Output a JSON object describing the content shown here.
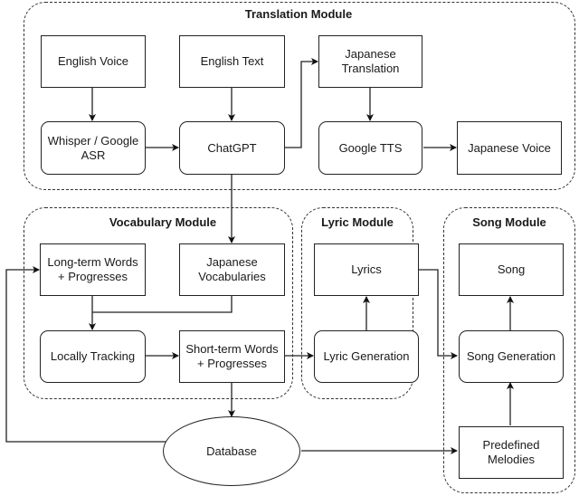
{
  "modules": {
    "translation": {
      "title": "Translation Module"
    },
    "vocabulary": {
      "title": "Vocabulary Module"
    },
    "lyric": {
      "title": "Lyric Module"
    },
    "song": {
      "title": "Song Module"
    }
  },
  "nodes": {
    "english_voice": "English Voice",
    "english_text": "English Text",
    "japanese_translation": "Japanese Translation",
    "whisper_asr": "Whisper / Google ASR",
    "chatgpt": "ChatGPT",
    "google_tts": "Google TTS",
    "japanese_voice": "Japanese Voice",
    "long_term_words": "Long-term Words + Progresses",
    "japanese_vocabularies": "Japanese Vocabularies",
    "locally_tracking": "Locally Tracking",
    "short_term_words": "Short-term Words + Progresses",
    "lyrics": "Lyrics",
    "lyric_generation": "Lyric Generation",
    "song": "Song",
    "song_generation": "Song Generation",
    "database": "Database",
    "predefined_melodies": "Predefined Melodies"
  },
  "edges": [
    {
      "from": "English Voice",
      "to": "Whisper / Google ASR"
    },
    {
      "from": "English Text",
      "to": "ChatGPT"
    },
    {
      "from": "Whisper / Google ASR",
      "to": "ChatGPT"
    },
    {
      "from": "ChatGPT",
      "to": "Japanese Translation"
    },
    {
      "from": "Japanese Translation",
      "to": "Google TTS"
    },
    {
      "from": "Google TTS",
      "to": "Japanese Voice"
    },
    {
      "from": "ChatGPT",
      "to": "Japanese Vocabularies"
    },
    {
      "from": "Long-term Words + Progresses",
      "to": "Locally Tracking"
    },
    {
      "from": "Japanese Vocabularies",
      "to": "Locally Tracking"
    },
    {
      "from": "Locally Tracking",
      "to": "Short-term Words + Progresses"
    },
    {
      "from": "Short-term Words + Progresses",
      "to": "Lyric Generation"
    },
    {
      "from": "Short-term Words + Progresses",
      "to": "Database"
    },
    {
      "from": "Lyric Generation",
      "to": "Lyrics"
    },
    {
      "from": "Lyrics",
      "to": "Song Generation"
    },
    {
      "from": "Song Generation",
      "to": "Song"
    },
    {
      "from": "Predefined Melodies",
      "to": "Song Generation"
    },
    {
      "from": "Database",
      "to": "Predefined Melodies"
    },
    {
      "from": "Database",
      "to": "Long-term Words + Progresses"
    }
  ]
}
